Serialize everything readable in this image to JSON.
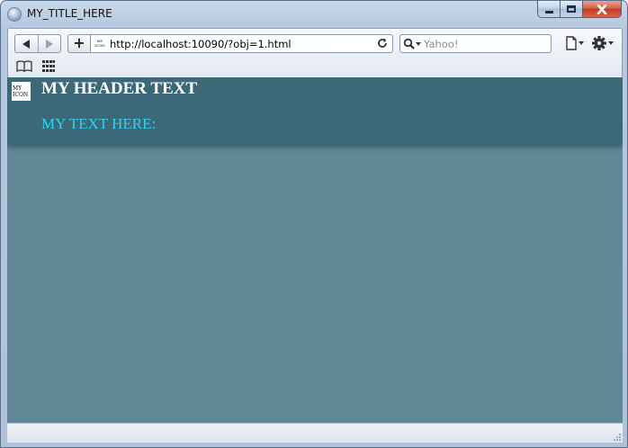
{
  "window": {
    "title": "MY_TITLE_HERE"
  },
  "toolbar": {
    "url": "http://localhost:10090/?obj=1.html",
    "site_icon_text": "MY ICON",
    "search_placeholder": "Yahoo!",
    "add_label": "+"
  },
  "page": {
    "icon_text": "MY ICON",
    "header_title": "MY HEADER TEXT",
    "subtext": "MY TEXT HERE:",
    "header_color": "#3d6878",
    "background_color": "#608896",
    "subtext_color": "#2fd3f2"
  },
  "icons": {
    "back": "back-arrow-icon",
    "forward": "forward-arrow-icon",
    "reload": "reload-icon",
    "search": "magnifier-icon",
    "page_menu": "page-icon",
    "settings": "gear-icon",
    "bookmarks": "open-book-icon",
    "top_sites": "grid-icon"
  }
}
